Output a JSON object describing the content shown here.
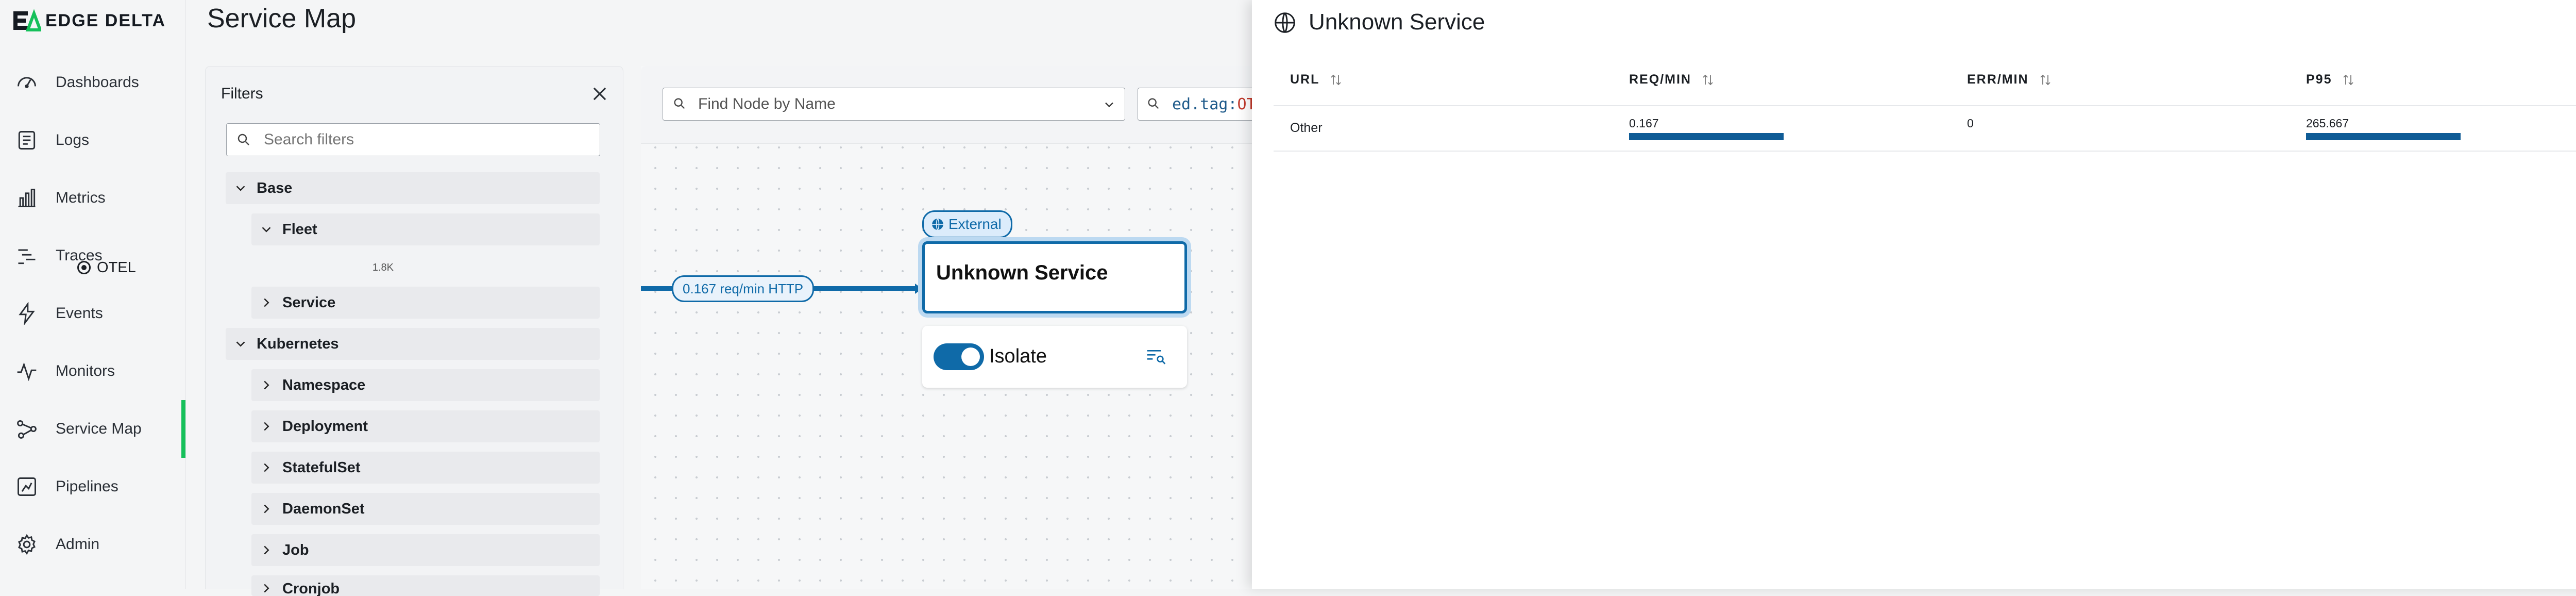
{
  "brand": {
    "name": "EDGE DELTA",
    "accent": "#15c05a"
  },
  "nav": {
    "items": [
      {
        "label": "Dashboards",
        "icon": "dashboard-gauge-icon"
      },
      {
        "label": "Logs",
        "icon": "logs-document-icon"
      },
      {
        "label": "Metrics",
        "icon": "bar-chart-icon"
      },
      {
        "label": "Traces",
        "icon": "traces-lines-icon"
      },
      {
        "label": "Events",
        "icon": "lightning-bolt-icon"
      },
      {
        "label": "Monitors",
        "icon": "pulse-line-icon"
      },
      {
        "label": "Service Map",
        "icon": "service-map-nodes-icon",
        "active": true
      },
      {
        "label": "Pipelines",
        "icon": "pipelines-icon"
      },
      {
        "label": "Admin",
        "icon": "gear-icon"
      }
    ]
  },
  "page": {
    "title": "Service Map"
  },
  "filters": {
    "title": "Filters",
    "search_placeholder": "Search filters",
    "groups": {
      "base": "Base",
      "fleet": "Fleet",
      "otel": {
        "label": "OTEL",
        "count": "1.8K",
        "selected": true
      },
      "service": "Service",
      "kubernetes": "Kubernetes",
      "namespace": "Namespace",
      "deployment": "Deployment",
      "statefulset": "StatefulSet",
      "daemonset": "DaemonSet",
      "job": "Job",
      "cronjob": "Cronjob"
    }
  },
  "canvas": {
    "find_placeholder": "Find Node by Name",
    "query_key": "ed.tag",
    "query_sep": ":",
    "query_value": "OT",
    "edge_label": "0.167 req/min HTTP",
    "node_tag": "External",
    "node_title": "Unknown Service",
    "isolate_label": "Isolate",
    "isolate_on": true
  },
  "panel": {
    "title": "Unknown Service",
    "columns": [
      "URL",
      "REQ/MIN",
      "ERR/MIN",
      "P95"
    ],
    "rows": [
      {
        "url": "Other",
        "req_min": "0.167",
        "err_min": "0",
        "p95": "265.667"
      }
    ],
    "bar_color": "#0f5c96"
  }
}
